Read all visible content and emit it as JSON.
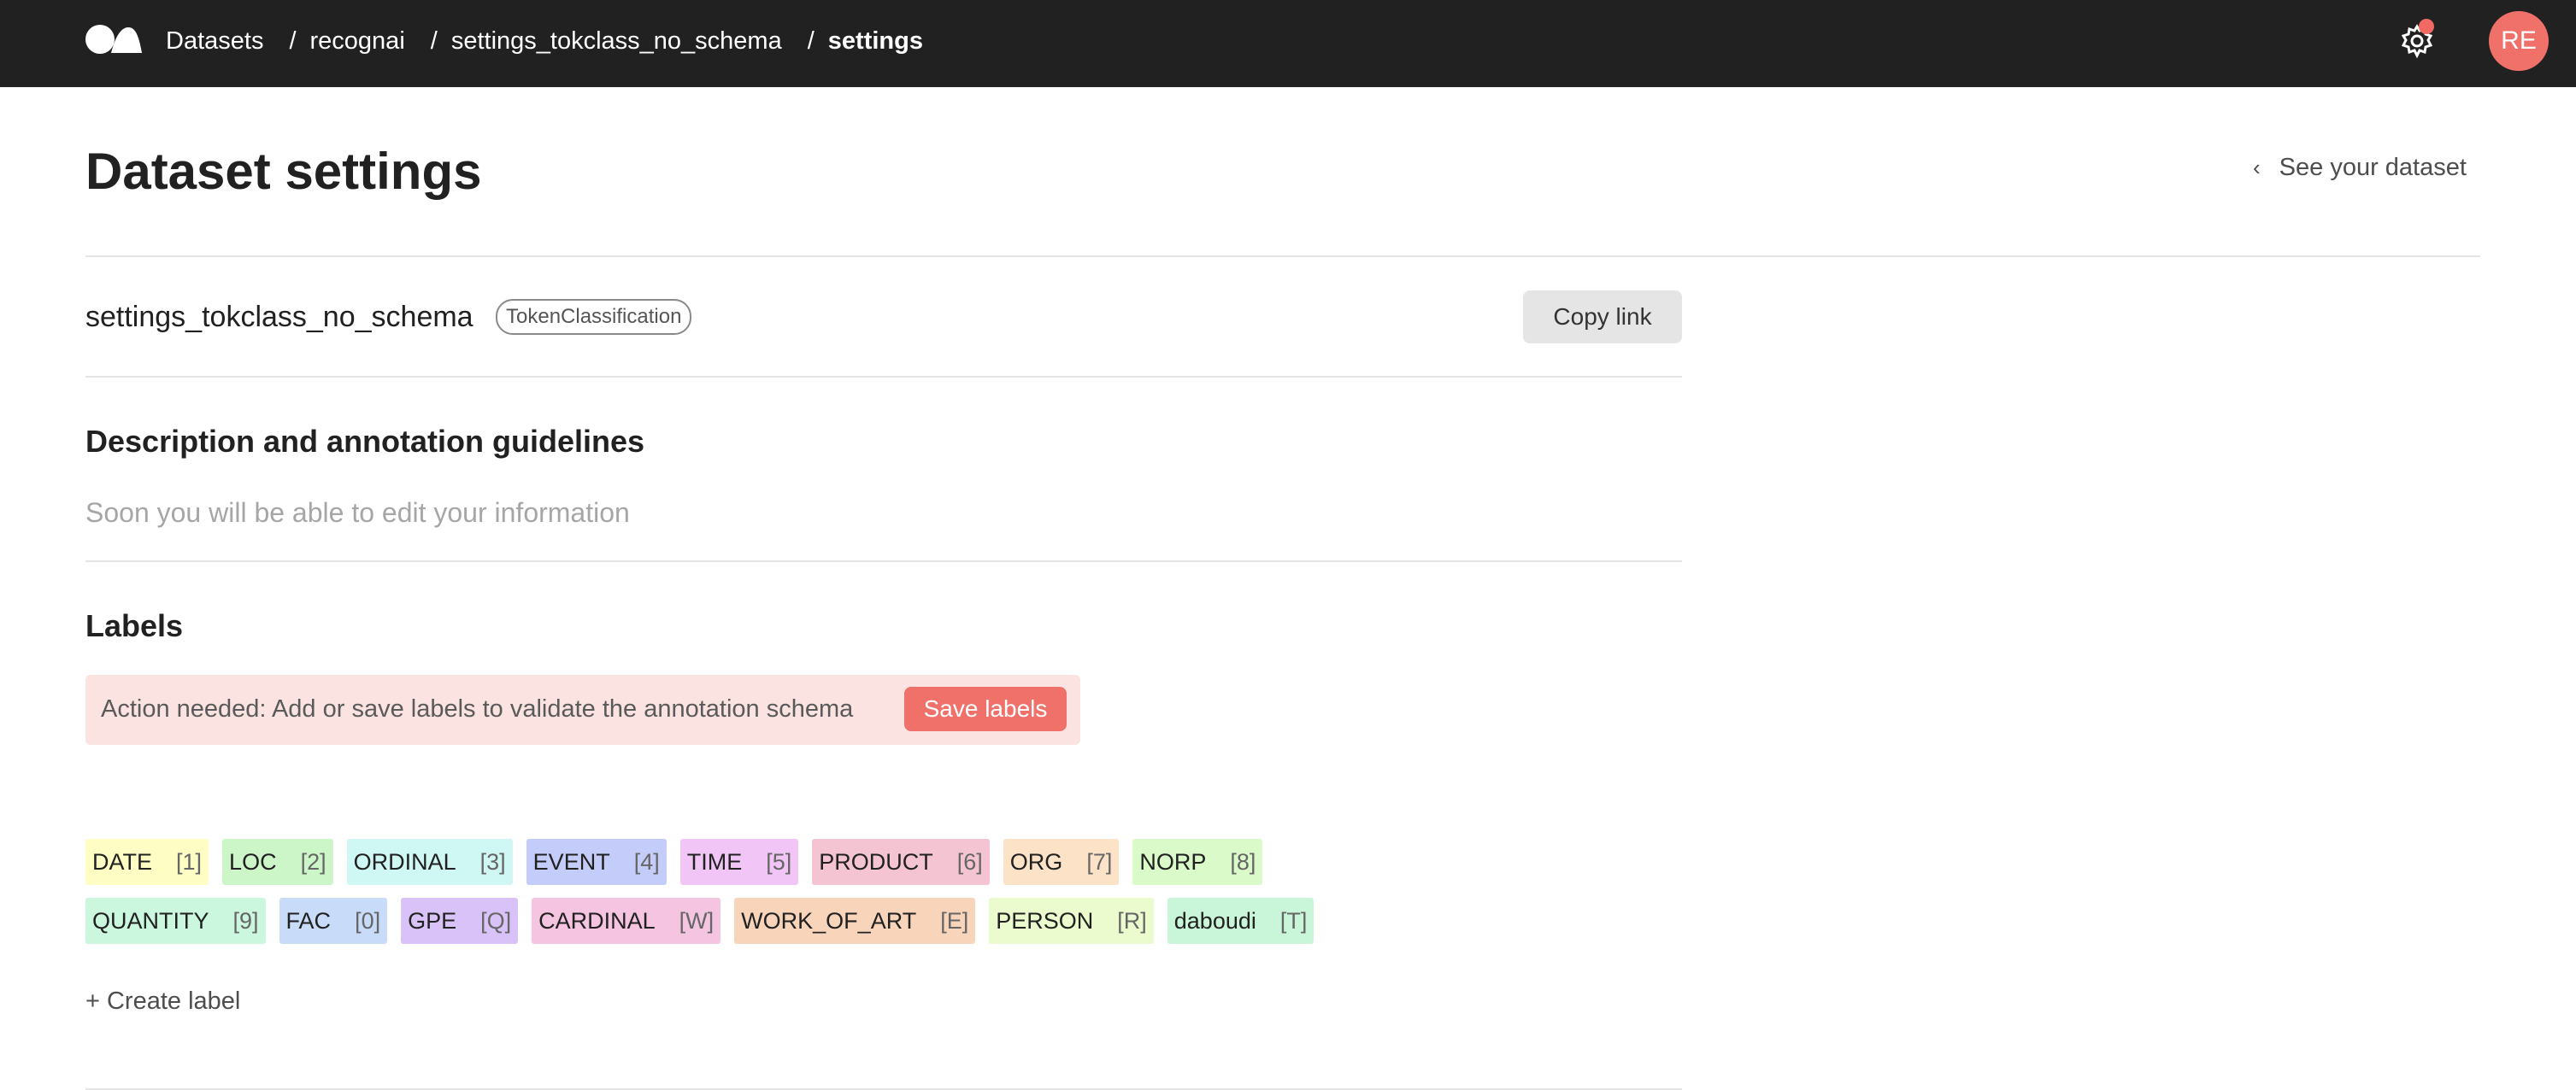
{
  "topbar": {
    "logo_icon": "argilla-logo-icon",
    "breadcrumbs": [
      "Datasets",
      "recognai",
      "settings_tokclass_no_schema",
      "settings"
    ],
    "separator": "/",
    "settings_icon": "gear-icon",
    "notification_color": "#f06a63",
    "avatar_initials": "RE",
    "avatar_color": "#f0706a"
  },
  "header": {
    "title": "Dataset settings",
    "back_icon": "chevron-left-icon",
    "back_label": "See your dataset"
  },
  "dataset": {
    "name": "settings_tokclass_no_schema",
    "task": "TokenClassification",
    "copy_label": "Copy link"
  },
  "description": {
    "title": "Description and annotation guidelines",
    "placeholder_text": "Soon you will be able to edit your information"
  },
  "labels": {
    "title": "Labels",
    "alert_text": "Action needed: Add or save labels to validate the annotation schema",
    "save_label": "Save labels",
    "items": [
      {
        "name": "DATE",
        "key": "[1]",
        "color": "#fdfdc4"
      },
      {
        "name": "LOC",
        "key": "[2]",
        "color": "#cdf6c8"
      },
      {
        "name": "ORDINAL",
        "key": "[3]",
        "color": "#cff7f3"
      },
      {
        "name": "EVENT",
        "key": "[4]",
        "color": "#c4cdf9"
      },
      {
        "name": "TIME",
        "key": "[5]",
        "color": "#f1c6f6"
      },
      {
        "name": "PRODUCT",
        "key": "[6]",
        "color": "#f4c4d3"
      },
      {
        "name": "ORG",
        "key": "[7]",
        "color": "#fce3c7"
      },
      {
        "name": "NORP",
        "key": "[8]",
        "color": "#dafac9"
      },
      {
        "name": "QUANTITY",
        "key": "[9]",
        "color": "#cbf7de"
      },
      {
        "name": "FAC",
        "key": "[0]",
        "color": "#c8dcf9"
      },
      {
        "name": "GPE",
        "key": "[Q]",
        "color": "#d9c2f7"
      },
      {
        "name": "CARDINAL",
        "key": "[W]",
        "color": "#f4c4e1"
      },
      {
        "name": "WORK_OF_ART",
        "key": "[E]",
        "color": "#f8d4ba"
      },
      {
        "name": "PERSON",
        "key": "[R]",
        "color": "#ecfbcd"
      },
      {
        "name": "daboudi",
        "key": "[T]",
        "color": "#c9f5d8"
      }
    ],
    "create_label": "+ Create label"
  }
}
